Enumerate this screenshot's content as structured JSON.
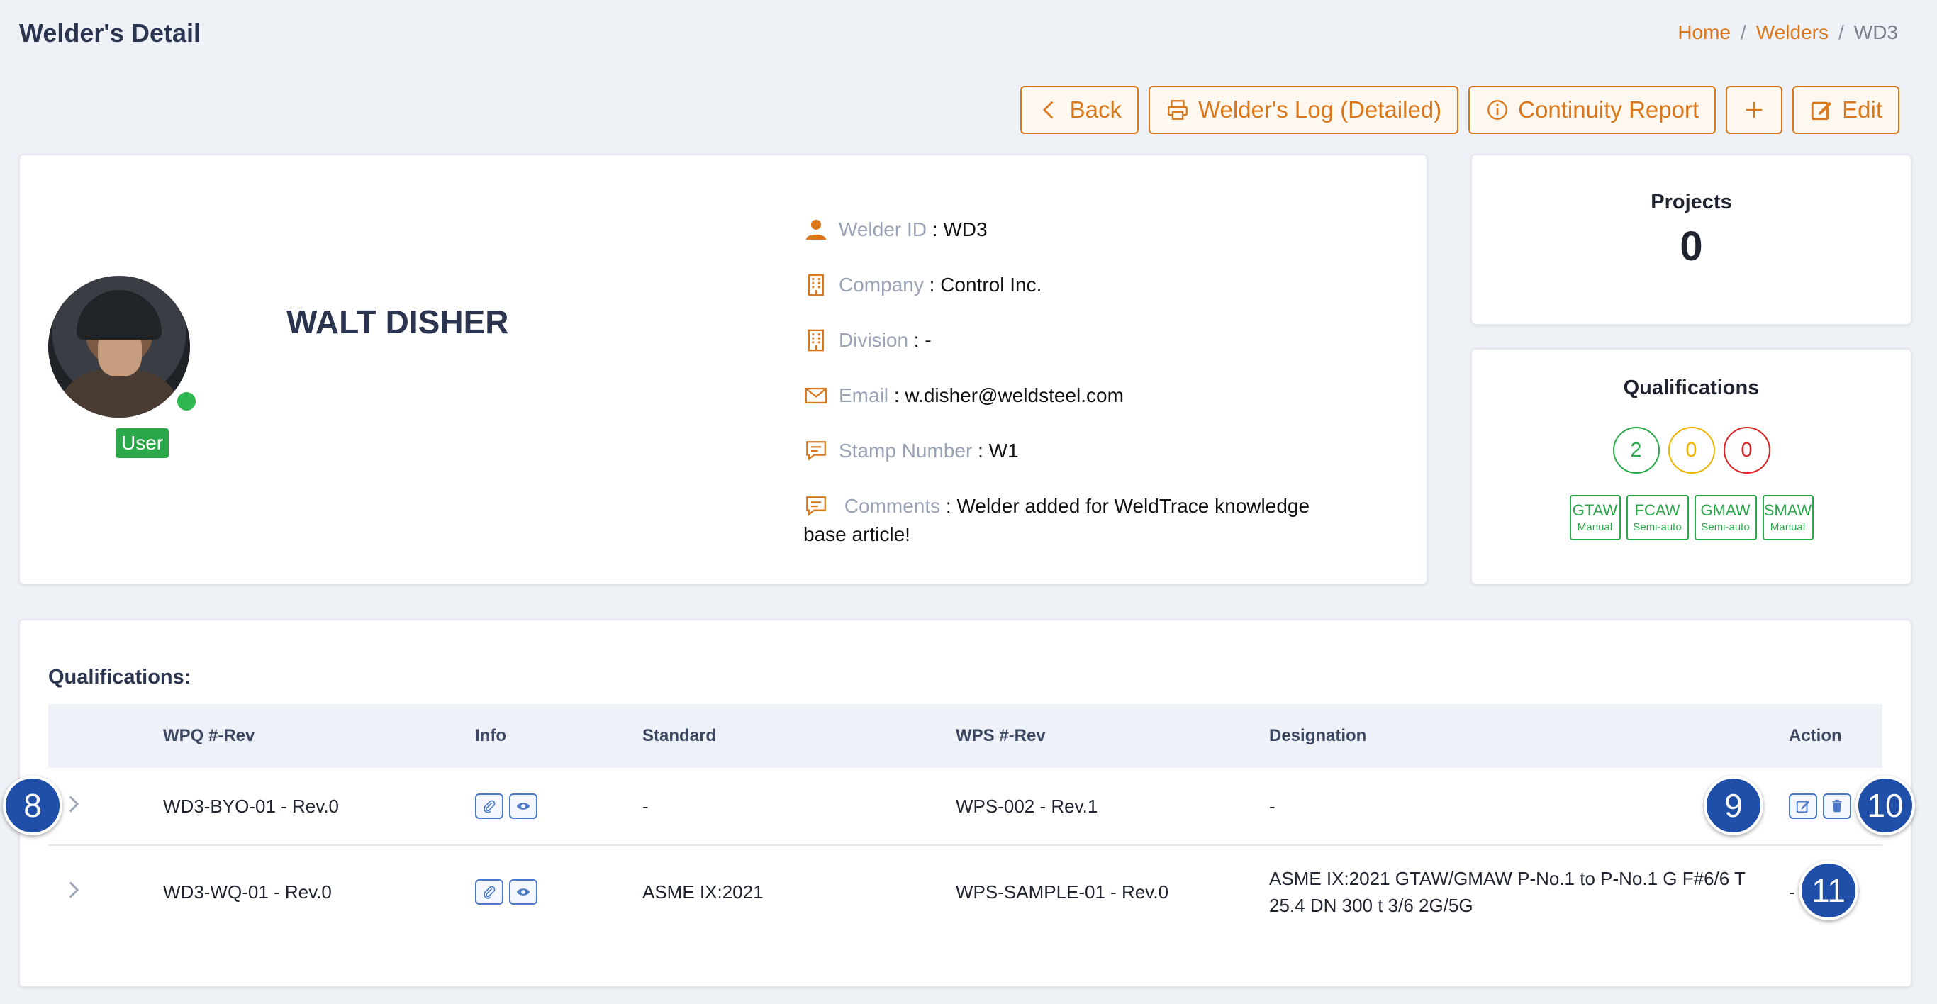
{
  "header": {
    "title": "Welder's Detail"
  },
  "breadcrumb": {
    "home": "Home",
    "welders": "Welders",
    "current": "WD3",
    "sep": "/"
  },
  "toolbar": {
    "back": "Back",
    "log": "Welder's Log (Detailed)",
    "continuity": "Continuity Report",
    "edit": "Edit"
  },
  "welder": {
    "name": "WALT DISHER",
    "role": "User",
    "fields": {
      "welder_id": {
        "label": "Welder ID",
        "value": "WD3"
      },
      "company": {
        "label": "Company",
        "value": "Control Inc."
      },
      "division": {
        "label": "Division",
        "value": "-"
      },
      "email": {
        "label": "Email",
        "value": "w.disher@weldsteel.com"
      },
      "stamp": {
        "label": "Stamp Number",
        "value": "W1"
      },
      "comments": {
        "label": "Comments",
        "value": "Welder added for WeldTrace knowledge base article!"
      }
    },
    "separator": " : "
  },
  "projects": {
    "title": "Projects",
    "count": "0"
  },
  "qualifications_summary": {
    "title": "Qualifications",
    "counts": {
      "green": "2",
      "yellow": "0",
      "red": "0"
    },
    "processes": [
      {
        "name": "GTAW",
        "mode": "Manual"
      },
      {
        "name": "FCAW",
        "mode": "Semi-auto"
      },
      {
        "name": "GMAW",
        "mode": "Semi-auto"
      },
      {
        "name": "SMAW",
        "mode": "Manual"
      }
    ]
  },
  "qual_table": {
    "title": "Qualifications:",
    "columns": {
      "wpq": "WPQ #-Rev",
      "info": "Info",
      "standard": "Standard",
      "wps": "WPS #-Rev",
      "designation": "Designation",
      "action": "Action"
    },
    "rows": [
      {
        "wpq": "WD3-BYO-01 - Rev.0",
        "standard": "-",
        "wps": "WPS-002 - Rev.1",
        "designation": "-",
        "action": ""
      },
      {
        "wpq": "WD3-WQ-01 - Rev.0",
        "standard": "ASME IX:2021",
        "wps": "WPS-SAMPLE-01 - Rev.0",
        "designation": "ASME IX:2021 GTAW/GMAW P-No.1 to P-No.1 G F#6/6 T 25.4 DN 300 t 3/6 2G/5G",
        "action": "-"
      }
    ]
  },
  "markers": {
    "m8": "8",
    "m9": "9",
    "m10": "10",
    "m11": "11"
  },
  "colors": {
    "accent": "#d9771a",
    "primary": "#2b3550",
    "success": "#2aa84a",
    "warning": "#f0b400",
    "danger": "#dc2626",
    "marker": "#1f4fa8"
  }
}
